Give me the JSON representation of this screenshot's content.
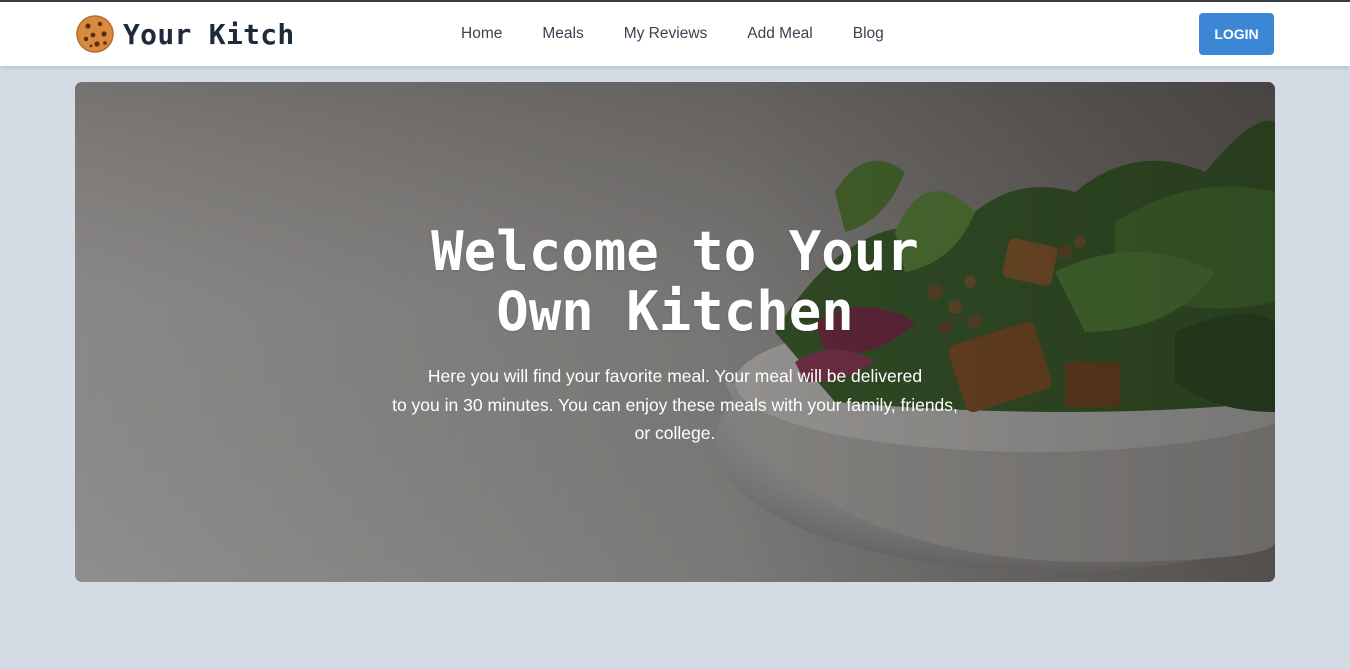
{
  "brand": {
    "name": "Your Kitch",
    "icon": "cookie-icon"
  },
  "nav": {
    "items": [
      {
        "label": "Home"
      },
      {
        "label": "Meals"
      },
      {
        "label": "My Reviews"
      },
      {
        "label": "Add Meal"
      },
      {
        "label": "Blog"
      }
    ]
  },
  "header": {
    "login_label": "LOGIN"
  },
  "hero": {
    "title_line1": "Welcome to Your",
    "title_line2": "Own Kitchen",
    "subtitle_line1": "Here you will find your favorite meal. Your meal will be delivered",
    "subtitle_line2": "to you in 30 minutes. You can enjoy these meals with your family, friends,",
    "subtitle_line3": "or college.",
    "image": "salad-bowl-photo"
  },
  "colors": {
    "page_background": "#d3dbe5",
    "accent": "#3b87d6",
    "brand_text": "#1e2a3b",
    "nav_text": "#3b4350"
  }
}
